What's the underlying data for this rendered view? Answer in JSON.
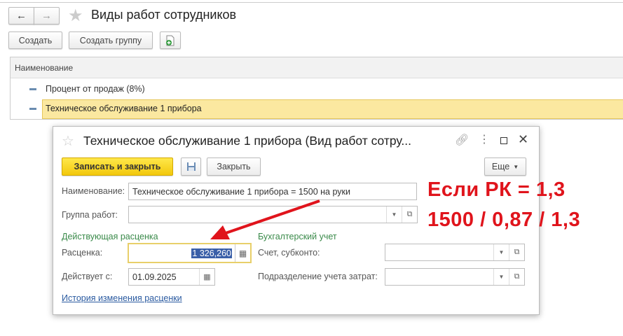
{
  "page": {
    "title": "Виды работ сотрудников",
    "create_label": "Создать",
    "create_group_label": "Создать группу"
  },
  "list": {
    "column_header": "Наименование",
    "rows": [
      {
        "name": "Процент от продаж (8%)"
      },
      {
        "name": "Техническое обслуживание 1 прибора",
        "selected": true
      }
    ]
  },
  "dialog": {
    "title": "Техническое обслуживание 1 прибора (Вид работ сотру...",
    "save_close_label": "Записать и закрыть",
    "close_label": "Закрыть",
    "more_label": "Еще",
    "name_label": "Наименование:",
    "name_value": "Техническое обслуживание 1 прибора = 1500 на руки",
    "group_label": "Группа работ:",
    "group_value": "",
    "rate_section": "Действующая расценка",
    "rate_label": "Расценка:",
    "rate_value": "1 326,260",
    "valid_from_label": "Действует с:",
    "valid_from_value": "01.09.2025",
    "accounting_section": "Бухгалтерский учет",
    "account_label": "Счет, субконто:",
    "department_label": "Подразделение учета затрат:",
    "history_link": "История изменения расценки"
  },
  "annotation": {
    "line1": "Если РК = 1,3",
    "line2": "1500 / 0,87 / 1,3",
    "color": "#e0141c"
  }
}
